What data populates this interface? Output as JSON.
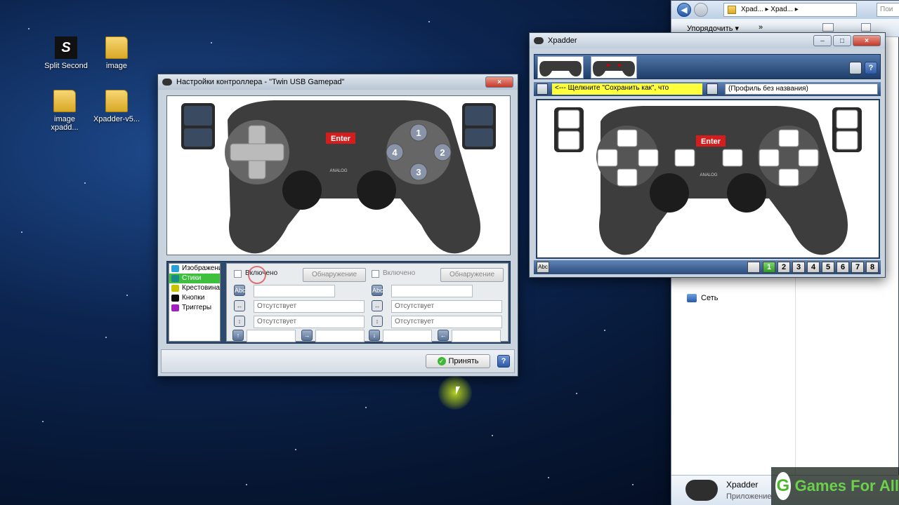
{
  "desktop": {
    "icons": [
      {
        "label": "Split Second",
        "badge": "S"
      },
      {
        "label": "image"
      },
      {
        "label": "image xpadd..."
      },
      {
        "label": "Xpadder-v5..."
      }
    ]
  },
  "settings_window": {
    "title": "Настройки контроллера - \"Twin USB Gamepad\"",
    "pad": {
      "enter_label": "Enter",
      "analog_label": "ANALOG",
      "buttons": [
        "1",
        "2",
        "3",
        "4"
      ]
    },
    "categories": [
      {
        "label": "Изображение",
        "color": "#2aa0d8"
      },
      {
        "label": "Стики",
        "color": "#1b8a8a"
      },
      {
        "label": "Крестовина",
        "color": "#c9c400"
      },
      {
        "label": "Кнопки",
        "color": "#0a0a0a"
      },
      {
        "label": "Триггеры",
        "color": "#a020c0"
      }
    ],
    "left_stick": {
      "enabled_label": "Включено",
      "detect_label": "Обнаружение",
      "abc_label": "Abc",
      "dropdown1": "Отсутствует",
      "dropdown2": "Отсутствует"
    },
    "right_stick": {
      "enabled_label": "Включено",
      "detect_label": "Обнаружение",
      "abc_label": "Abc",
      "dropdown1": "Отсутствует",
      "dropdown2": "Отсутствует"
    },
    "apply_label": "Принять",
    "help_label": "?"
  },
  "xpadder_window": {
    "title": "Xpadder",
    "hint_text": "<--- Щелкните \"Сохранить как\", что",
    "profile_text": "(Профиль без названия)",
    "enter_label": "Enter",
    "analog_label": "ANALOG",
    "abc_label": "Abc",
    "help_label": "?",
    "set_numbers": [
      "1",
      "2",
      "3",
      "4",
      "5",
      "6",
      "7",
      "8"
    ]
  },
  "explorer": {
    "path_1": "Xpad...",
    "path_2": "Xpad...",
    "search_placeholder": "Пои",
    "organize_label": "Упорядочить ▾",
    "network_label": "Сеть",
    "status_title": "Xpadder",
    "status_subtitle": "Приложение"
  },
  "watermark": {
    "letter": "G",
    "text": "Games For All"
  }
}
